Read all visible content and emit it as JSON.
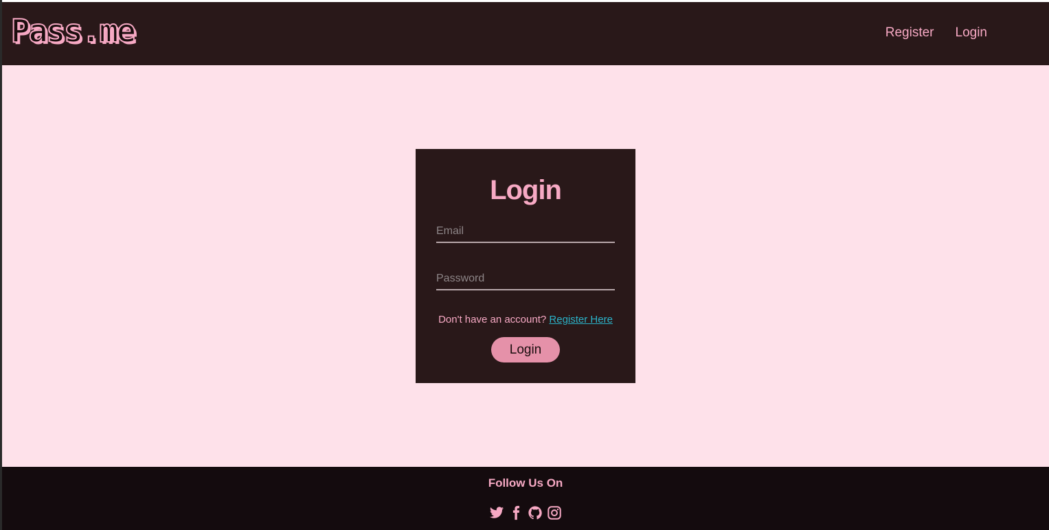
{
  "header": {
    "logo": "Pass.me",
    "nav": [
      {
        "label": "Register"
      },
      {
        "label": "Login"
      }
    ]
  },
  "login_card": {
    "title": "Login",
    "email_placeholder": "Email",
    "password_placeholder": "Password",
    "prompt_text": "Don't have an account?",
    "register_link": "Register Here",
    "submit_label": "Login"
  },
  "footer": {
    "title": "Follow Us On",
    "social_icons": [
      "twitter-icon",
      "facebook-icon",
      "github-icon",
      "instagram-icon"
    ]
  },
  "colors": {
    "page_bg": "#fee1ea",
    "header_bg": "#291819",
    "accent": "#f7a9c4",
    "button": "#e591a9",
    "link": "#2bb3c9",
    "footer_bg": "#140b0e"
  }
}
